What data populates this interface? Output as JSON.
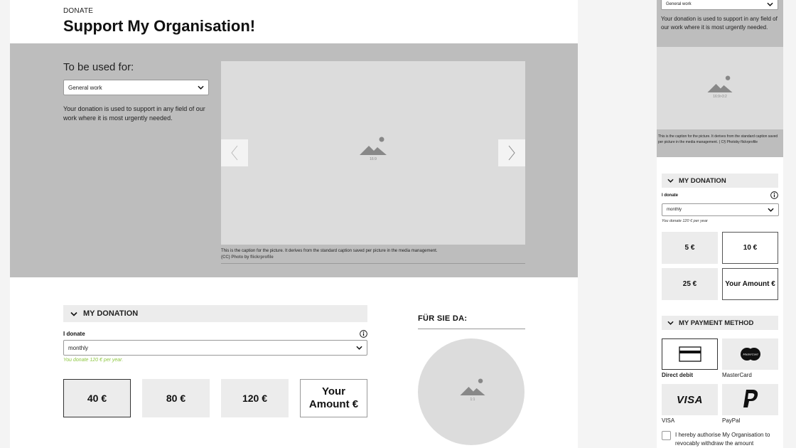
{
  "desktop": {
    "eyebrow": "DONATE",
    "title": "Support My Organisation!",
    "used_for_label": "To be used for:",
    "purpose_select": "General work",
    "purpose_desc": "Your donation is used to support in any field of our work where it is most urgently needed.",
    "carousel": {
      "ratio": "16:9",
      "caption": "This is the caption for the picture. It derives from the standard caption saved per picture in the media management.",
      "credit_cc": "(CC) Photo",
      "credit_by": " by ",
      "credit_author": "flickrprofile"
    },
    "donation": {
      "header": "MY DONATION",
      "i_donate": "I donate",
      "frequency": "monthly",
      "hint": "You donate 120 € per year.",
      "amounts": [
        "40 €",
        "80 €",
        "120 €"
      ],
      "custom_amount": "Your Amount €",
      "selected_index": 0
    },
    "sidebar": {
      "title": "FÜR SIE DA:",
      "ratio": "1:1"
    }
  },
  "mobile": {
    "purpose_select": "General work",
    "purpose_desc": "Your donation is used to support in any field of our work where it is most urgently needed.",
    "image_ratio": "16:9>3:2",
    "caption": "This is the caption for the picture. It derives from the standard caption saved per picture in the media management. ( C§  Photoby  flickrprofile",
    "donation": {
      "header": "MY DONATION",
      "i_donate": "I donate",
      "frequency": "monthly",
      "hint": "You donate 120 € per year",
      "amounts": [
        "5 €",
        "10 €",
        "25 €"
      ],
      "custom_amount": "Your Amount €"
    },
    "payment": {
      "header": "MY PAYMENT METHOD",
      "methods": [
        "Direct debit",
        "MasterCard",
        "VISA",
        "PayPal"
      ],
      "visa_logo": "VISA",
      "mastercard_logo": "MasterCard"
    },
    "consent": "I hereby authorise My Organisation to revocably withdraw the amount"
  },
  "colors": {
    "band": "#bdbdbd",
    "placeholder": "#dcdcdc",
    "tile": "#ececec",
    "hint_green": "#8cc63f"
  }
}
